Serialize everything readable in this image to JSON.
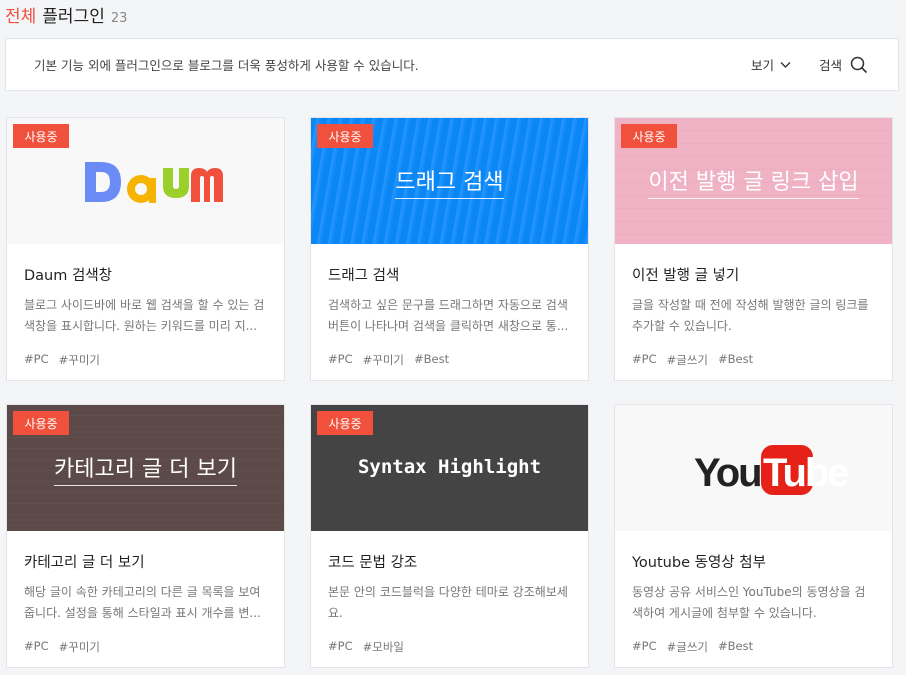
{
  "header": {
    "accent": "전체",
    "title": "플러그인",
    "count": "23"
  },
  "info": {
    "text": "기본 기능 외에 플러그인으로 블로그를 더욱 풍성하게 사용할 수 있습니다.",
    "view_label": "보기",
    "search_label": "검색"
  },
  "colors": {
    "accent": "#f0503c",
    "badge_text": "#ffffff"
  },
  "cards": [
    {
      "badge": "사용중",
      "logo_text": "Daum",
      "name": "Daum 검색창",
      "desc": "블로그 사이드바에 바로 웹 검색을 할 수 있는 검색창을 표시합니다. 원하는 키워드를 미리 지...",
      "tags": [
        "#PC",
        "#꾸미기"
      ]
    },
    {
      "badge": "사용중",
      "thumb_title": "드래그 검색",
      "name": "드래그 검색",
      "desc": "검색하고 싶은 문구를 드래그하면 자동으로 검색버튼이 나타나며 검색을 클릭하면 새창으로 통...",
      "tags": [
        "#PC",
        "#꾸미기",
        "#Best"
      ]
    },
    {
      "badge": "사용중",
      "thumb_title": "이전 발행 글 링크 삽입",
      "name": "이전 발행 글 넣기",
      "desc": "글을 작성할 때 전에 작성해 발행한 글의 링크를 추가할 수 있습니다.",
      "tags": [
        "#PC",
        "#글쓰기",
        "#Best"
      ]
    },
    {
      "badge": "사용중",
      "thumb_title": "카테고리 글 더 보기",
      "name": "카테고리 글 더 보기",
      "desc": "해당 글이 속한 카테고리의 다른 글 목록을 보여줍니다. 설정을 통해 스타일과 표시 개수를 변...",
      "tags": [
        "#PC",
        "#꾸미기"
      ]
    },
    {
      "badge": "사용중",
      "thumb_title": "Syntax Highlight",
      "name": "코드 문법 강조",
      "desc": "본문 안의 코드블럭을 다양한 테마로 강조해보세요.",
      "tags": [
        "#PC",
        "#모바일"
      ]
    },
    {
      "logo_text": "YouTube",
      "name": "Youtube 동영상 첨부",
      "desc": "동영상 공유 서비스인 YouTube의 동영상을 검색하여 게시글에 첨부할 수 있습니다.",
      "tags": [
        "#PC",
        "#글쓰기",
        "#Best"
      ]
    }
  ]
}
